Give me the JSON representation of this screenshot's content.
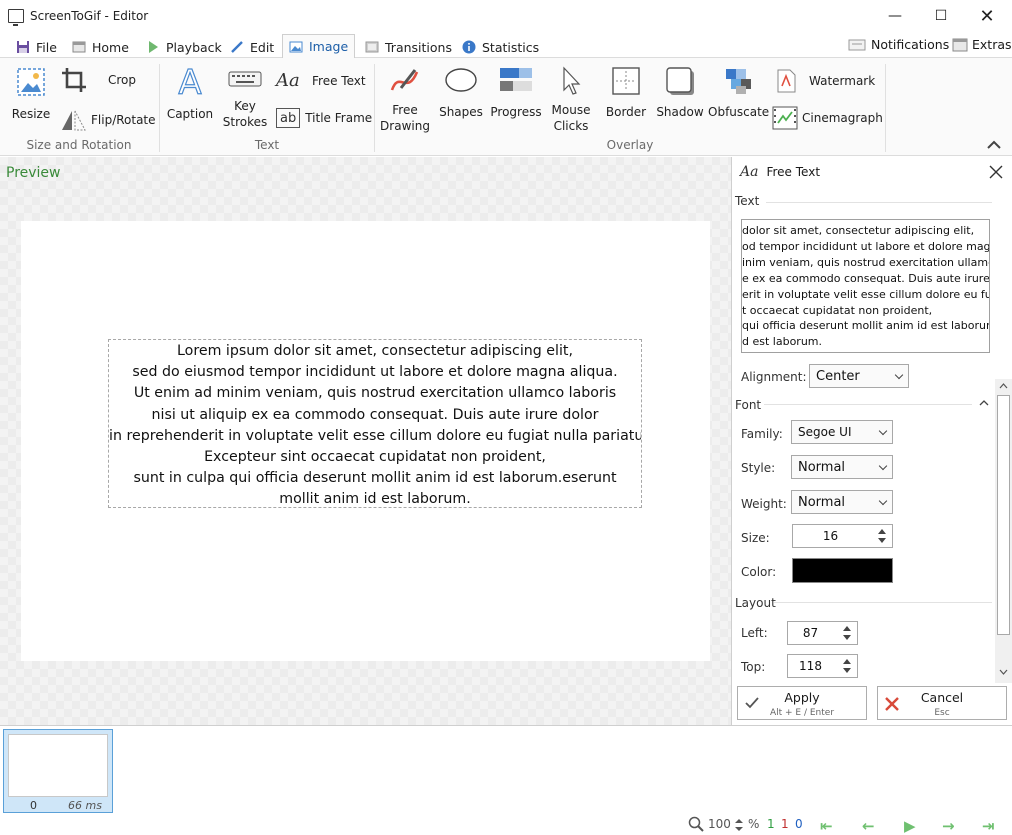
{
  "window": {
    "title": "ScreenToGif - Editor"
  },
  "tabs": [
    {
      "label": "File"
    },
    {
      "label": "Home"
    },
    {
      "label": "Playback"
    },
    {
      "label": "Edit"
    },
    {
      "label": "Image"
    },
    {
      "label": "Transitions"
    },
    {
      "label": "Statistics"
    }
  ],
  "tab_right": {
    "notifications": "Notifications",
    "extras": "Extras"
  },
  "ribbon": {
    "resize": "Resize",
    "crop": "Crop",
    "flip_rotate": "Flip/Rotate",
    "group_size": "Size and Rotation",
    "caption": "Caption",
    "key_strokes_1": "Key",
    "key_strokes_2": "Strokes",
    "free_text": "Free Text",
    "title_frame": "Title Frame",
    "group_text": "Text",
    "free_drawing_1": "Free",
    "free_drawing_2": "Drawing",
    "shapes": "Shapes",
    "progress": "Progress",
    "mouse_clicks_1": "Mouse",
    "mouse_clicks_2": "Clicks",
    "border": "Border",
    "shadow": "Shadow",
    "obfuscate": "Obfuscate",
    "watermark": "Watermark",
    "cinemagraph": "Cinemagraph",
    "group_overlay": "Overlay"
  },
  "preview": {
    "label": "Preview",
    "lines": [
      "Lorem ipsum dolor sit amet, consectetur adipiscing elit,",
      "sed do eiusmod tempor incididunt ut labore et dolore magna aliqua.",
      "Ut enim ad minim veniam, quis nostrud exercitation ullamco laboris",
      "nisi ut aliquip ex ea commodo consequat. Duis aute irure dolor",
      "in reprehenderit in voluptate velit esse cillum dolore eu fugiat nulla pariatur.",
      "Excepteur sint occaecat cupidatat non proident,",
      "sunt in culpa qui officia deserunt mollit anim id est laborum.eserunt",
      "mollit anim id est laborum."
    ]
  },
  "panel": {
    "title": "Free Text",
    "text_section": "Text",
    "text_lines": [
      " dolor sit amet, consectetur adipiscing elit,",
      "od tempor incididunt ut labore et dolore mag",
      "inim veniam, quis nostrud exercitation ullamc",
      "e ex ea commodo consequat. Duis aute irure d",
      "erit in voluptate velit esse cillum dolore eu fug",
      "t occaecat cupidatat non proident,",
      " qui officia deserunt mollit anim id est laborun",
      "d est laborum."
    ],
    "alignment_label": "Alignment:",
    "alignment_value": "Center",
    "font_section": "Font",
    "family_label": "Family:",
    "family_value": "Segoe UI",
    "style_label": "Style:",
    "style_value": "Normal",
    "weight_label": "Weight:",
    "weight_value": "Normal",
    "size_label": "Size:",
    "size_value": "16",
    "color_label": "Color:",
    "color_value": "#000000",
    "layout_section": "Layout",
    "left_label": "Left:",
    "left_value": "87",
    "top_label": "Top:",
    "top_value": "118",
    "apply_label": "Apply",
    "apply_shortcut": "Alt + E / Enter",
    "cancel_label": "Cancel",
    "cancel_shortcut": "Esc"
  },
  "frames": [
    {
      "index": "0",
      "delay": "66 ms"
    }
  ],
  "status": {
    "zoom": "100",
    "percent": "%",
    "n1": "1",
    "n2": "1",
    "n3": "0"
  }
}
